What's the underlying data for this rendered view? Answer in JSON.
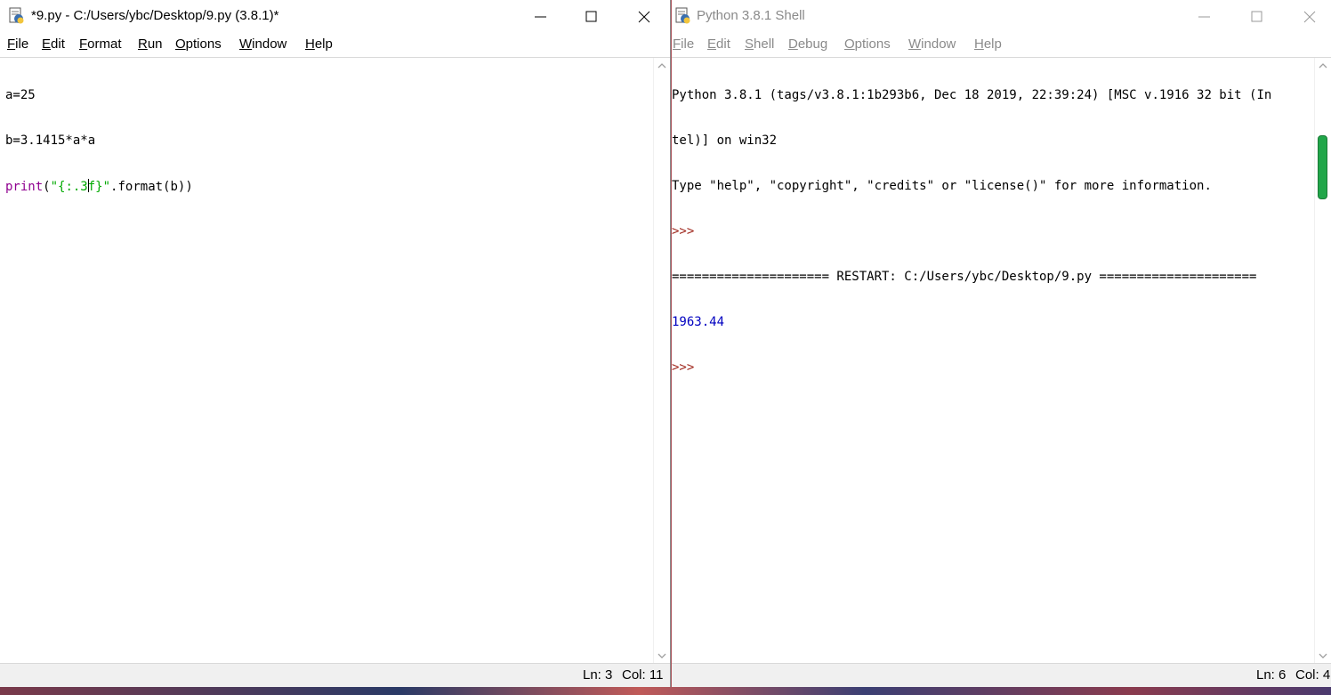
{
  "editor": {
    "title": "*9.py - C:/Users/ybc/Desktop/9.py (3.8.1)*",
    "menu": [
      "File",
      "Edit",
      "Format",
      "Run",
      "Options",
      "Window",
      "Help"
    ],
    "code": {
      "line1": "a=25",
      "line2": "b=3.1415*a*a",
      "line3_builtin": "print",
      "line3_open": "(",
      "line3_str_a": "\"{:.3",
      "line3_str_b": "f}\"",
      "line3_rest": ".format(b))"
    },
    "status": {
      "ln": "Ln: 3",
      "col": "Col: 11"
    }
  },
  "shell": {
    "title": "Python 3.8.1 Shell",
    "menu": [
      "File",
      "Edit",
      "Shell",
      "Debug",
      "Options",
      "Window",
      "Help"
    ],
    "lines": {
      "l1": "Python 3.8.1 (tags/v3.8.1:1b293b6, Dec 18 2019, 22:39:24) [MSC v.1916 32 bit (In",
      "l2": "tel)] on win32",
      "l3": "Type \"help\", \"copyright\", \"credits\" or \"license()\" for more information.",
      "prompt1": ">>>",
      "restart": "===================== RESTART: C:/Users/ybc/Desktop/9.py =====================",
      "output": "1963.44",
      "prompt2": ">>>"
    },
    "status": {
      "ln": "Ln: 6",
      "col": "Col: 4"
    }
  },
  "colors": {
    "scroll_thumb": "#21a649",
    "builtin": "#900090",
    "string": "#00aa00",
    "output": "#0000c0",
    "prompt": "#a0281e"
  },
  "icons": [
    "python-idle-icon",
    "minimize-icon",
    "maximize-icon",
    "close-icon",
    "scroll-up-arrow-icon",
    "scroll-down-arrow-icon"
  ]
}
